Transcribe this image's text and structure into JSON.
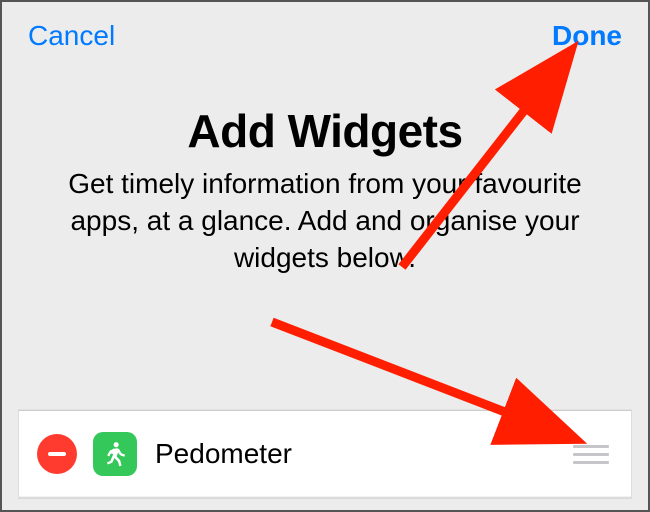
{
  "navbar": {
    "left_label": "Cancel",
    "right_label": "Done"
  },
  "hero": {
    "title": "Add Widgets",
    "description": "Get timely information from your favourite apps, at a glance. Add and organise your widgets below."
  },
  "list": {
    "items": [
      {
        "app_name": "Pedometer"
      }
    ]
  },
  "colors": {
    "tint": "#007aff",
    "remove": "#ff3b30",
    "app_icon_bg": "#34c759",
    "annotation": "#ff1e00"
  }
}
